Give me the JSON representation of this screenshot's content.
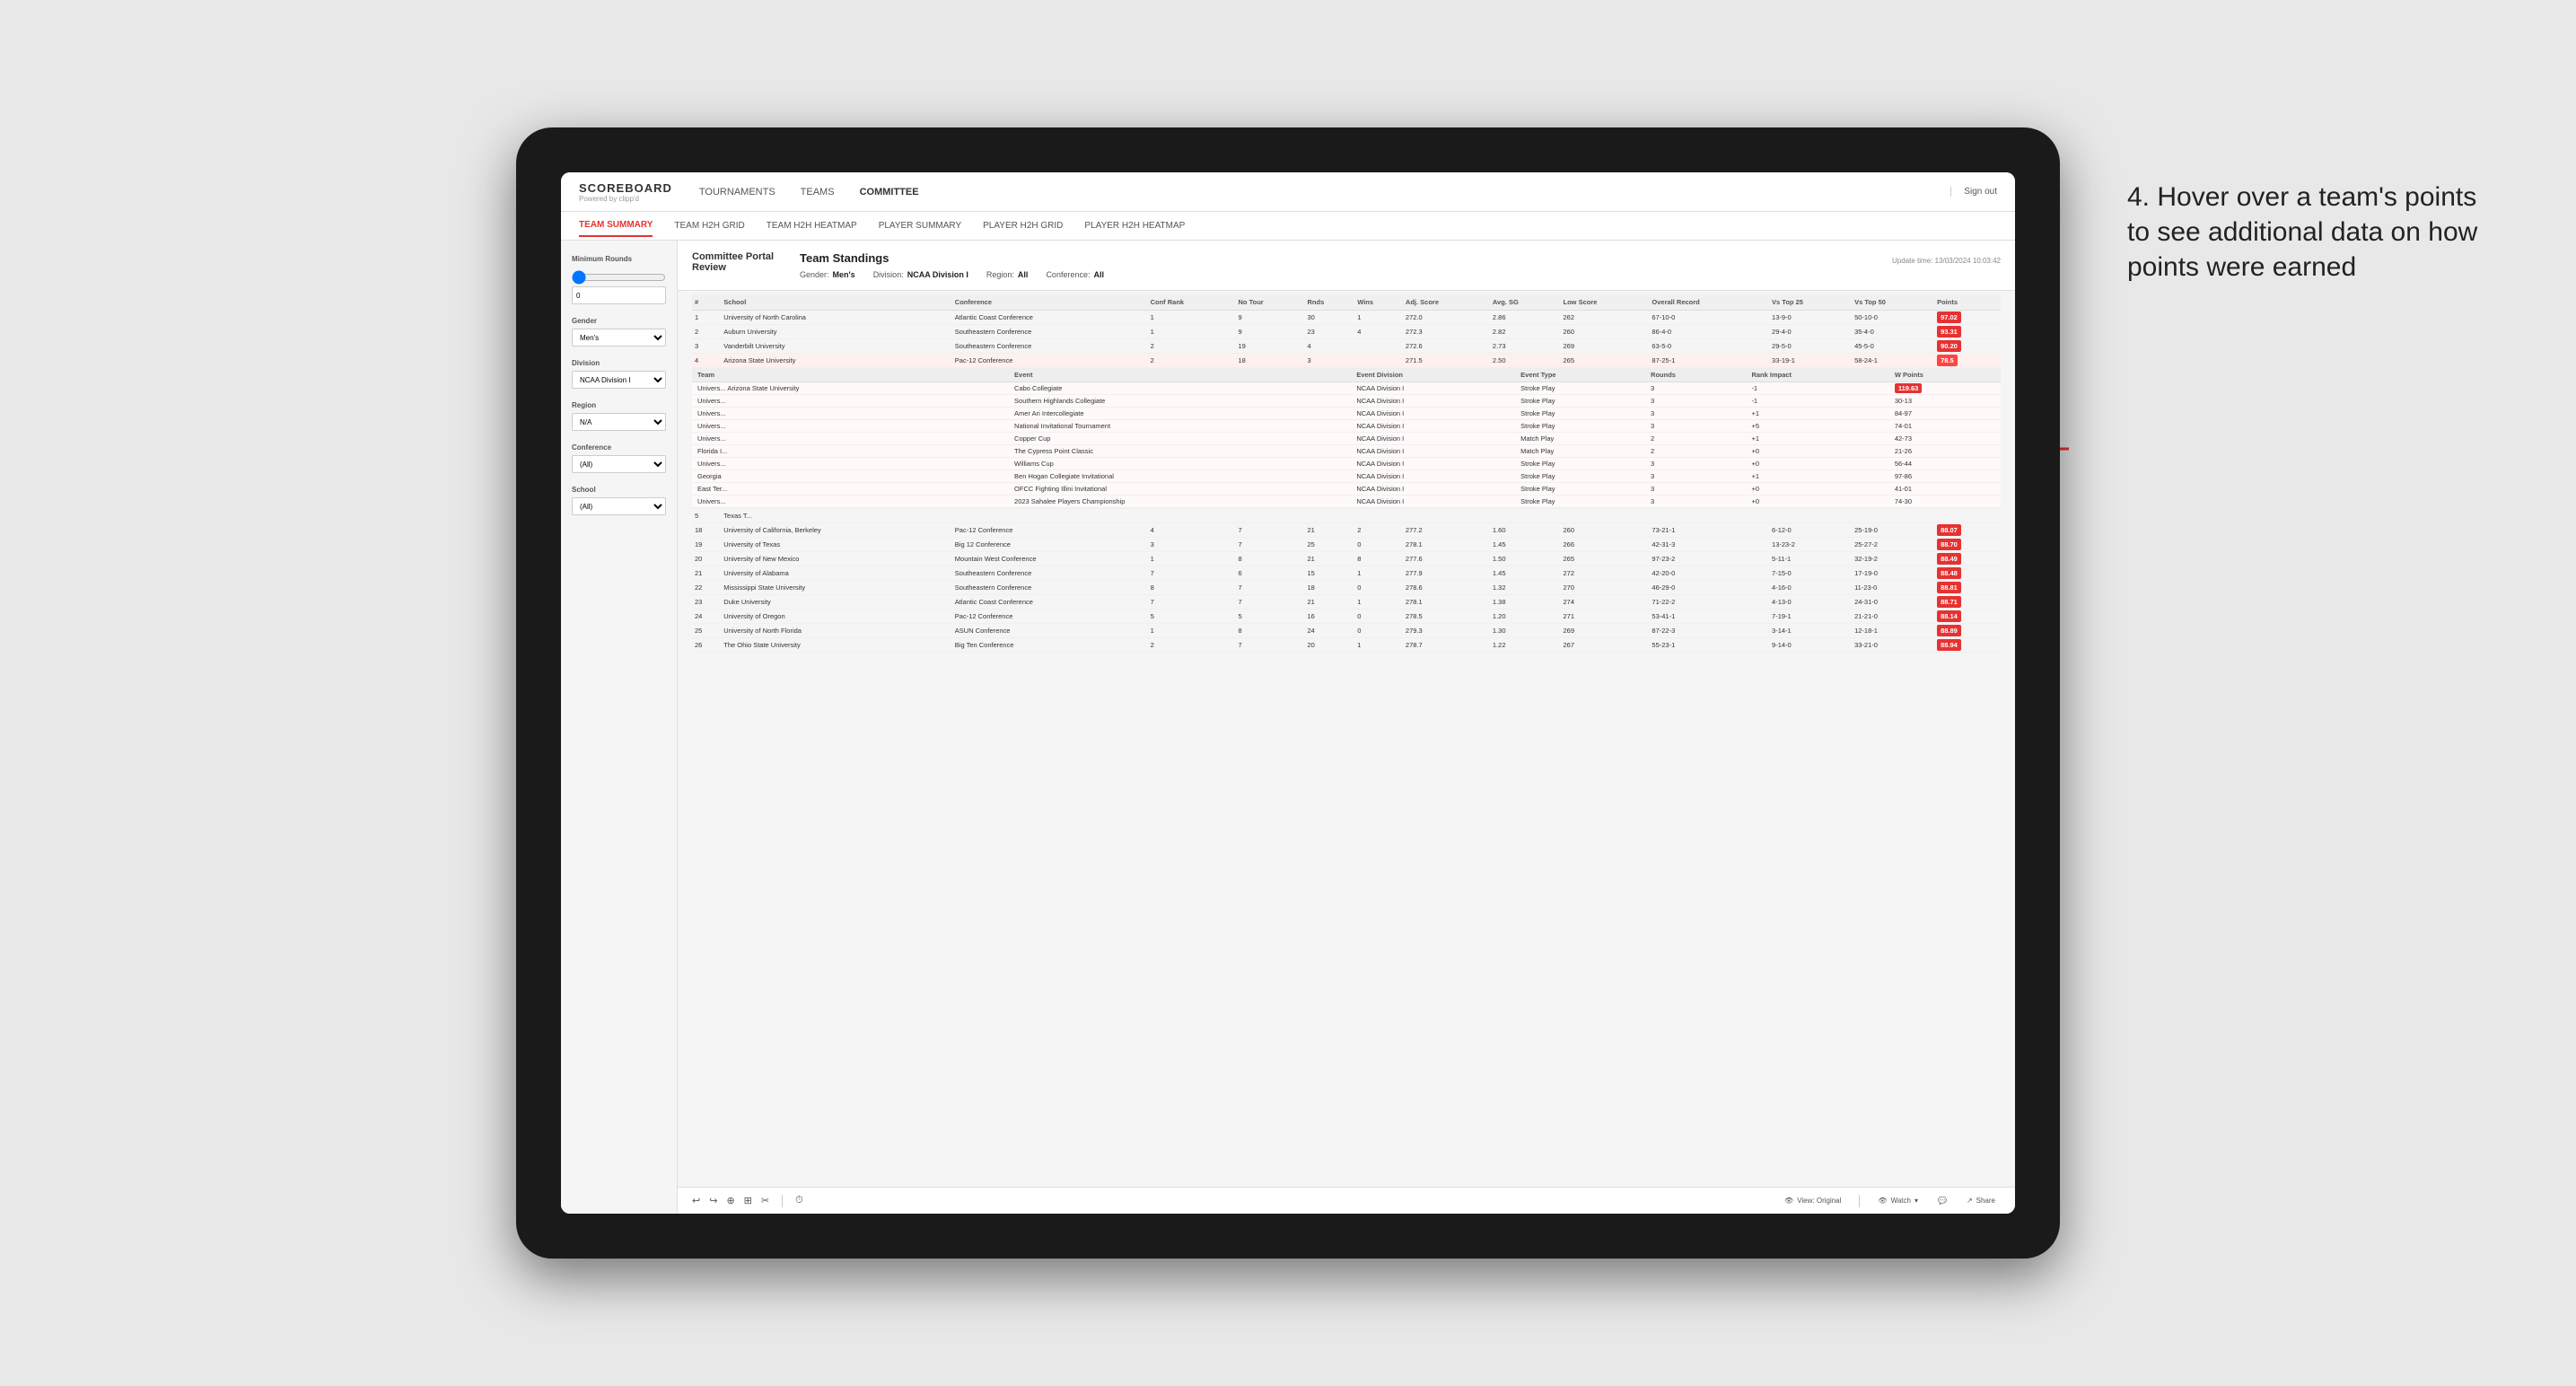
{
  "app": {
    "logo": "SCOREBOARD",
    "logo_sub": "Powered by clipp'd",
    "sign_out": "Sign out"
  },
  "nav": {
    "items": [
      "TOURNAMENTS",
      "TEAMS",
      "COMMITTEE"
    ]
  },
  "sub_nav": {
    "items": [
      "TEAM SUMMARY",
      "TEAM H2H GRID",
      "TEAM H2H HEATMAP",
      "PLAYER SUMMARY",
      "PLAYER H2H GRID",
      "PLAYER H2H HEATMAP"
    ],
    "active": "TEAM SUMMARY"
  },
  "sidebar": {
    "min_rounds_label": "Minimum Rounds",
    "gender_label": "Gender",
    "gender_value": "Men's",
    "division_label": "Division",
    "division_value": "NCAA Division I",
    "region_label": "Region",
    "region_value": "N/A",
    "conference_label": "Conference",
    "conference_value": "(All)",
    "school_label": "School",
    "school_value": "(All)"
  },
  "portal": {
    "title": "Committee Portal Review",
    "standings_title": "Team Standings",
    "update_time": "Update time: 13/03/2024 10:03:42",
    "gender": "Men's",
    "division": "NCAA Division I",
    "region": "All",
    "conference": "All"
  },
  "table": {
    "columns": [
      "#",
      "School",
      "Conference",
      "Conf Rank",
      "No Tour",
      "Rnds",
      "Wins",
      "Adj. Score",
      "Avg. SG",
      "Low Score",
      "Overall Record",
      "Vs Top 25",
      "Vs Top 50",
      "Points"
    ],
    "rows": [
      {
        "rank": "1",
        "school": "University of North Carolina",
        "conference": "Atlantic Coast Conference",
        "conf_rank": "1",
        "no_tour": "9",
        "rnds": "30",
        "wins": "1",
        "adj_score": "272.0",
        "avg_sg": "2.86",
        "low_score": "262",
        "overall": "67-10-0",
        "vs25": "13-9-0",
        "vs50": "50-10-0",
        "points": "97.02",
        "highlight": true
      },
      {
        "rank": "2",
        "school": "Auburn University",
        "conference": "Southeastern Conference",
        "conf_rank": "1",
        "no_tour": "9",
        "rnds": "23",
        "wins": "4",
        "adj_score": "272.3",
        "avg_sg": "2.82",
        "low_score": "260",
        "overall": "86-4-0",
        "vs25": "29-4-0",
        "vs50": "35-4-0",
        "points": "93.31"
      },
      {
        "rank": "3",
        "school": "Vanderbilt University",
        "conference": "Southeastern Conference",
        "conf_rank": "2",
        "no_tour": "19",
        "rnds": "4",
        "adj_score": "272.6",
        "avg_sg": "2.73",
        "low_score": "269",
        "overall": "63-5-0",
        "vs25": "29-5-0",
        "vs50": "45-5-0",
        "points": "90.20"
      },
      {
        "rank": "4",
        "school": "Arizona State University",
        "conference": "Pac-12 Conference",
        "conf_rank": "2",
        "no_tour": "18",
        "rnds": "3",
        "adj_score": "271.5",
        "avg_sg": "2.50",
        "low_score": "265",
        "overall": "87-25-1",
        "vs25": "33-19-1",
        "vs50": "58-24-1",
        "points": "78.5",
        "highlight": true,
        "expanded": true
      },
      {
        "rank": "5",
        "school": "Texas T...",
        "conference": "",
        "conf_rank": "",
        "no_tour": "",
        "rnds": "",
        "wins": "",
        "adj_score": "",
        "avg_sg": "",
        "low_score": "",
        "overall": "",
        "vs25": "",
        "vs50": "",
        "points": ""
      }
    ],
    "expanded_cols": [
      "Team",
      "Event",
      "Event Division",
      "Event Type",
      "Rounds",
      "Rank Impact",
      "W Points"
    ],
    "expanded_rows": [
      {
        "team": "Univers... Arizona State University",
        "event": "Cabo Collegiate",
        "event_div": "NCAA Division I",
        "event_type": "Stroke Play",
        "rounds": "3",
        "rank_impact": "-1",
        "points": "119.63",
        "highlight": true
      },
      {
        "team": "Univers...",
        "event": "Southern Highlands Collegiate",
        "event_div": "NCAA Division I",
        "event_type": "Stroke Play",
        "rounds": "3",
        "rank_impact": "-1",
        "points": "30-13"
      },
      {
        "team": "Univers...",
        "event": "Amer Ari Intercollegiate",
        "event_div": "NCAA Division I",
        "event_type": "Stroke Play",
        "rounds": "3",
        "rank_impact": "+1",
        "points": "84-97"
      },
      {
        "team": "Univers...",
        "event": "National Invitational Tournament",
        "event_div": "NCAA Division I",
        "event_type": "Stroke Play",
        "rounds": "3",
        "rank_impact": "+5",
        "points": "74-01"
      },
      {
        "team": "Univers...",
        "event": "Copper Cup",
        "event_div": "NCAA Division I",
        "event_type": "Match Play",
        "rounds": "2",
        "rank_impact": "+1",
        "points": "42-73"
      },
      {
        "team": "Florida I...",
        "event": "The Cypress Point Classic",
        "event_div": "NCAA Division I",
        "event_type": "Match Play",
        "rounds": "2",
        "rank_impact": "+0",
        "points": "21-26"
      },
      {
        "team": "Univers...",
        "event": "Williams Cup",
        "event_div": "NCAA Division I",
        "event_type": "Stroke Play",
        "rounds": "3",
        "rank_impact": "+0",
        "points": "56-44"
      },
      {
        "team": "Georgia",
        "event": "Ben Hogan Collegiate Invitational",
        "event_div": "NCAA Division I",
        "event_type": "Stroke Play",
        "rounds": "3",
        "rank_impact": "+1",
        "points": "97-86"
      },
      {
        "team": "East Ter...",
        "event": "OFCC Fighting Illini Invitational",
        "event_div": "NCAA Division I",
        "event_type": "Stroke Play",
        "rounds": "3",
        "rank_impact": "+0",
        "points": "41-01"
      },
      {
        "team": "Univers...",
        "event": "2023 Sahalee Players Championship",
        "event_div": "NCAA Division I",
        "event_type": "Stroke Play",
        "rounds": "3",
        "rank_impact": "+0",
        "points": "74-30"
      }
    ],
    "lower_rows": [
      {
        "rank": "18",
        "school": "University of California, Berkeley",
        "conference": "Pac-12 Conference",
        "conf_rank": "4",
        "no_tour": "7",
        "rnds": "21",
        "wins": "2",
        "adj_score": "277.2",
        "avg_sg": "1.60",
        "low_score": "260",
        "overall": "73-21-1",
        "vs25": "6-12-0",
        "vs50": "25-19-0",
        "points": "88-07"
      },
      {
        "rank": "19",
        "school": "University of Texas",
        "conference": "Big 12 Conference",
        "conf_rank": "3",
        "no_tour": "7",
        "rnds": "25",
        "wins": "0",
        "adj_score": "278.1",
        "avg_sg": "1.45",
        "low_score": "266",
        "overall": "42-31-3",
        "vs25": "13-23-2",
        "vs50": "25-27-2",
        "points": "88-70"
      },
      {
        "rank": "20",
        "school": "University of New Mexico",
        "conference": "Mountain West Conference",
        "conf_rank": "1",
        "no_tour": "8",
        "rnds": "21",
        "wins": "8",
        "adj_score": "277.6",
        "avg_sg": "1.50",
        "low_score": "265",
        "overall": "97-23-2",
        "vs25": "5-11-1",
        "vs50": "32-19-2",
        "points": "88-49"
      },
      {
        "rank": "21",
        "school": "University of Alabama",
        "conference": "Southeastern Conference",
        "conf_rank": "7",
        "no_tour": "6",
        "rnds": "15",
        "wins": "1",
        "adj_score": "277.9",
        "avg_sg": "1.45",
        "low_score": "272",
        "overall": "42-20-0",
        "vs25": "7-15-0",
        "vs50": "17-19-0",
        "points": "88-48"
      },
      {
        "rank": "22",
        "school": "Mississippi State University",
        "conference": "Southeastern Conference",
        "conf_rank": "8",
        "no_tour": "7",
        "rnds": "18",
        "wins": "0",
        "adj_score": "278.6",
        "avg_sg": "1.32",
        "low_score": "270",
        "overall": "46-29-0",
        "vs25": "4-16-0",
        "vs50": "11-23-0",
        "points": "88-81"
      },
      {
        "rank": "23",
        "school": "Duke University",
        "conference": "Atlantic Coast Conference",
        "conf_rank": "7",
        "no_tour": "7",
        "rnds": "21",
        "wins": "1",
        "adj_score": "278.1",
        "avg_sg": "1.38",
        "low_score": "274",
        "overall": "71-22-2",
        "vs25": "4-13-0",
        "vs50": "24-31-0",
        "points": "88-71"
      },
      {
        "rank": "24",
        "school": "University of Oregon",
        "conference": "Pac-12 Conference",
        "conf_rank": "5",
        "no_tour": "5",
        "rnds": "16",
        "wins": "0",
        "adj_score": "278.5",
        "avg_sg": "1.20",
        "low_score": "271",
        "overall": "53-41-1",
        "vs25": "7-19-1",
        "vs50": "21-21-0",
        "points": "88-14"
      },
      {
        "rank": "25",
        "school": "University of North Florida",
        "conference": "ASUN Conference",
        "conf_rank": "1",
        "no_tour": "8",
        "rnds": "24",
        "wins": "0",
        "adj_score": "279.3",
        "avg_sg": "1.30",
        "low_score": "269",
        "overall": "87-22-3",
        "vs25": "3-14-1",
        "vs50": "12-18-1",
        "points": "88-89"
      },
      {
        "rank": "26",
        "school": "The Ohio State University",
        "conference": "Big Ten Conference",
        "conf_rank": "2",
        "no_tour": "7",
        "rnds": "20",
        "wins": "1",
        "adj_score": "278.7",
        "avg_sg": "1.22",
        "low_score": "267",
        "overall": "55-23-1",
        "vs25": "9-14-0",
        "vs50": "33-21-0",
        "points": "88-94"
      }
    ]
  },
  "toolbar": {
    "undo": "↩",
    "redo": "↪",
    "zoom": "⊕",
    "view_label": "View: Original",
    "watch_label": "Watch",
    "share_label": "Share"
  },
  "annotation": {
    "text": "4. Hover over a team's points to see additional data on how points were earned"
  }
}
